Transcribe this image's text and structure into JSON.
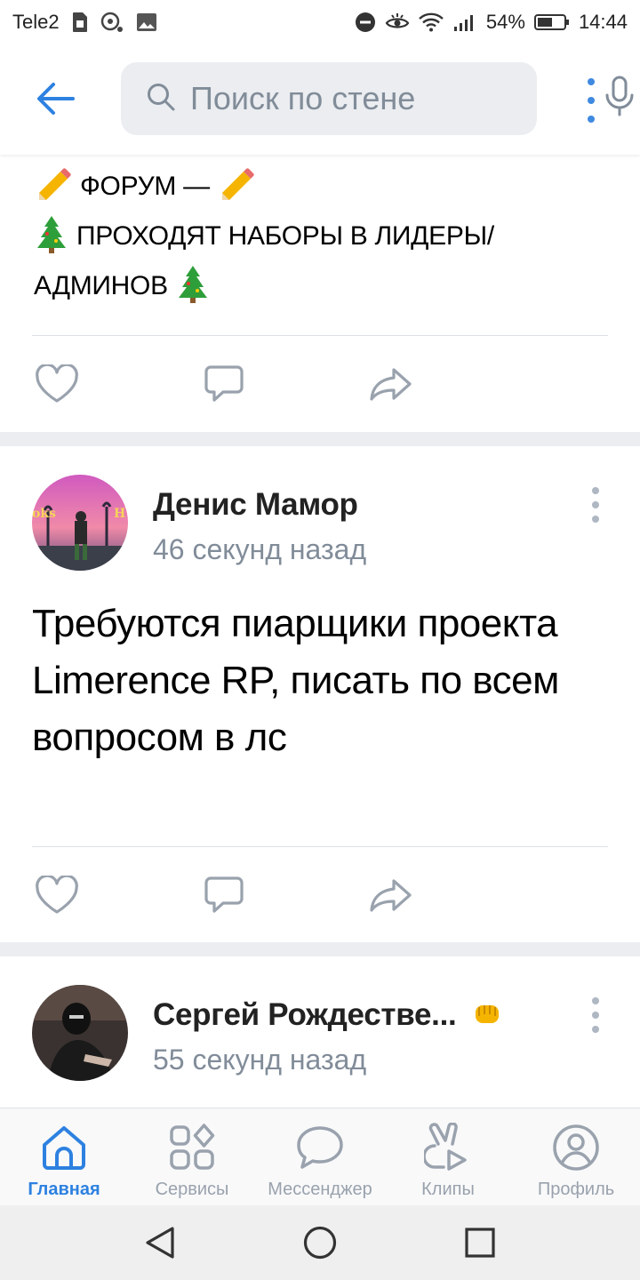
{
  "status_bar": {
    "carrier": "Tele2",
    "battery": "54%",
    "time": "14:44"
  },
  "header": {
    "search_placeholder": "Поиск по стене"
  },
  "posts": [
    {
      "lines": [
        "ФОРУМ —",
        "ПРОХОДЯТ НАБОРЫ В ЛИДЕРЫ/",
        "АДМИНОВ"
      ]
    },
    {
      "author": "Денис Мамор",
      "time": "46 секунд назад",
      "text": "Требуются пиарщики проекта Limerence RP, писать по всем вопросом в лс"
    },
    {
      "author": "Сергей Рождестве...",
      "time": "55 секунд назад"
    }
  ],
  "tabs": [
    {
      "label": "Главная",
      "active": true
    },
    {
      "label": "Сервисы"
    },
    {
      "label": "Мессенджер"
    },
    {
      "label": "Клипы"
    },
    {
      "label": "Профиль"
    }
  ],
  "colors": {
    "accent": "#2d81e0",
    "icon_gray": "#99a2ad",
    "divider": "#dce1e6",
    "background": "#ebedf0"
  }
}
